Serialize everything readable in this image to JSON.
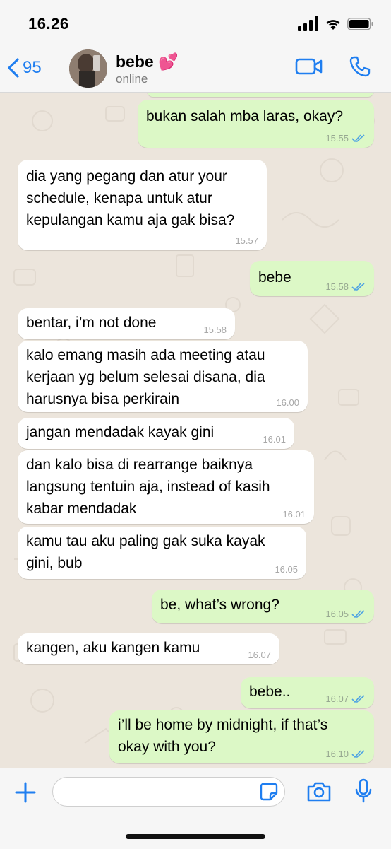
{
  "status_bar": {
    "time": "16.26"
  },
  "header": {
    "back_count": "95",
    "contact_name": "bebe 💕",
    "contact_status": "online"
  },
  "messages": [
    {
      "dir": "out",
      "text": "bukan salah mba laras, okay?",
      "time": "15.55",
      "read": true
    },
    {
      "dir": "in",
      "text": "dia yang pegang dan atur your\nschedule, kenapa untuk atur\nkepulangan kamu aja gak bisa?",
      "time": "15.57"
    },
    {
      "dir": "out",
      "text": "bebe",
      "time": "15.58",
      "read": true
    },
    {
      "dir": "in",
      "text": "bentar, i’m not done",
      "time": "15.58"
    },
    {
      "dir": "in",
      "text": "kalo emang masih ada meeting atau\nkerjaan yg belum selesai disana, dia\nharusnya bisa perkirain",
      "time": "16.00"
    },
    {
      "dir": "in",
      "text": "jangan mendadak kayak gini",
      "time": "16.01"
    },
    {
      "dir": "in",
      "text": "dan kalo bisa di rearrange baiknya\nlangsung tentuin aja, instead of kasih\nkabar mendadak",
      "time": "16.01"
    },
    {
      "dir": "in",
      "text": "kamu tau aku paling gak suka kayak\ngini, bub",
      "time": "16.05"
    },
    {
      "dir": "out",
      "text": "be, what’s wrong?",
      "time": "16.05",
      "read": true
    },
    {
      "dir": "in",
      "text": "kangen, aku kangen kamu",
      "time": "16.07"
    },
    {
      "dir": "out",
      "text": "bebe..",
      "time": "16.07",
      "read": true
    },
    {
      "dir": "out",
      "text": "i’ll be home by midnight, if that’s\nokay with you?",
      "time": "16.10",
      "read": true
    }
  ],
  "composer": {
    "placeholder": ""
  },
  "colors": {
    "accent": "#1f7ef0",
    "outgoing": "#dcf8c6",
    "incoming": "#ffffff",
    "read_tick": "#4fa3e3"
  }
}
